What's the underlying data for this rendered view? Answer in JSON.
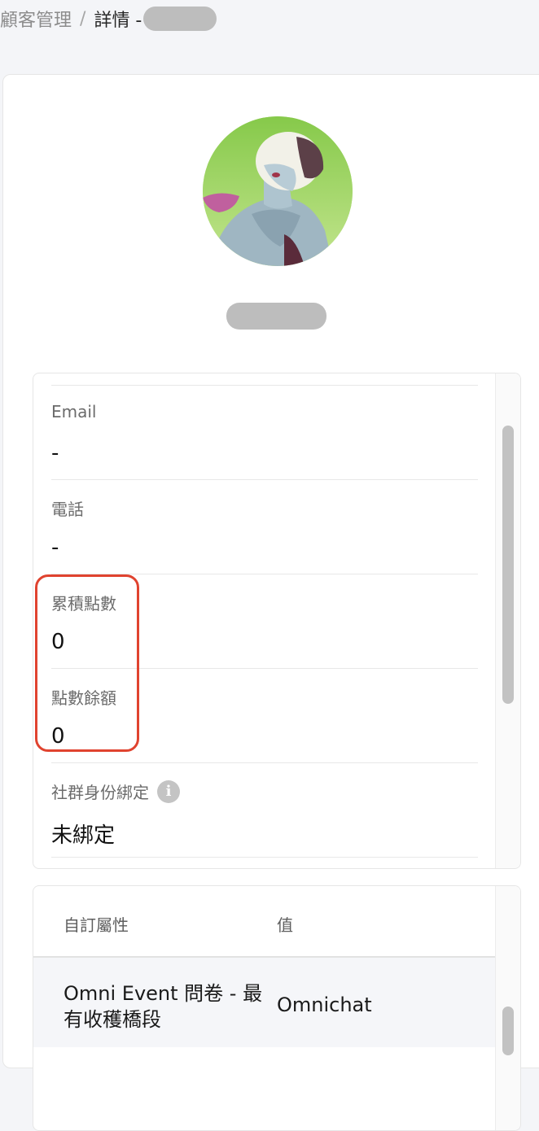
{
  "breadcrumb": {
    "root": "顧客管理",
    "separator": "/",
    "current": "詳情 -"
  },
  "fields": [
    {
      "label": "Email",
      "value": "-"
    },
    {
      "label": "電話",
      "value": "-"
    },
    {
      "label": "累積點數",
      "value": "0"
    },
    {
      "label": "點數餘額",
      "value": "0"
    },
    {
      "label": "社群身份綁定",
      "value": "未綁定",
      "icon": "info-icon"
    }
  ],
  "attributes": {
    "header_name": "自訂屬性",
    "header_value": "值",
    "rows": [
      {
        "name": "Omni Event 問卷 - 最有收穫橋段",
        "value": "Omnichat"
      }
    ]
  },
  "colors": {
    "highlight": "#e0432f",
    "avatar_bg": "#9fd35e"
  }
}
